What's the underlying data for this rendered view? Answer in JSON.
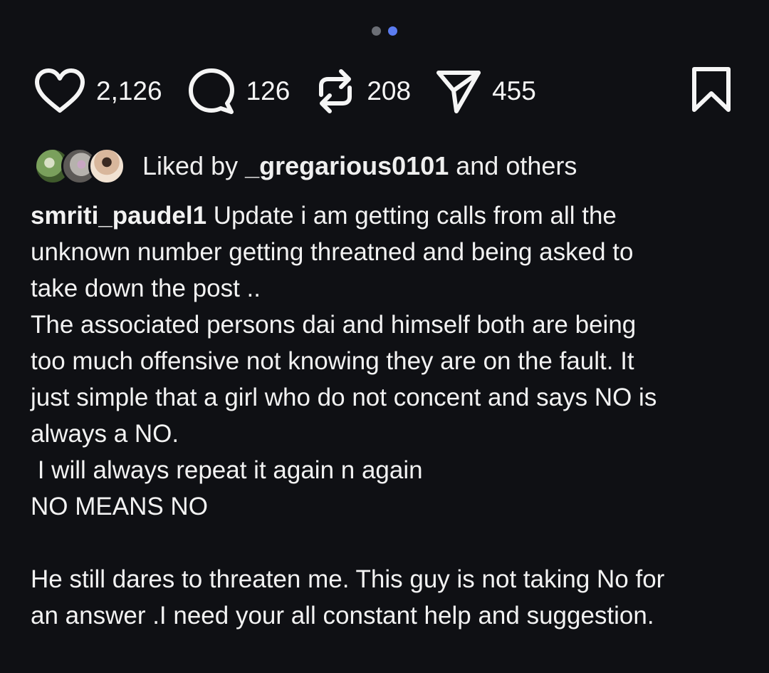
{
  "pager": {
    "count": 2,
    "active_index": 1
  },
  "actions": {
    "like_count": "2,126",
    "comment_count": "126",
    "repost_count": "208",
    "share_count": "455"
  },
  "liked_by": {
    "prefix": "Liked by ",
    "user": "_gregarious0101",
    "suffix": " and others"
  },
  "caption": {
    "username": "smriti_paudel1",
    "line1": " Update i am getting calls from all the",
    "line2": "unknown number getting threatned and being asked to",
    "line3": "take down the post ..",
    "line4": "The associated persons dai and himself both are being",
    "line5": "too much offensive not knowing they are on the fault. It",
    "line6": "just simple that a girl who do not concent and says NO is",
    "line7": "always a NO.",
    "line8": " I will always repeat it again n again",
    "line9": "NO MEANS NO",
    "line10": "He still dares to threaten me. This guy is not taking No for",
    "line11": "an answer .I need your all constant help and suggestion."
  },
  "colors": {
    "background": "#0f1014",
    "text": "#f2f2f2",
    "pager_active": "#5b7cf0",
    "pager_inactive": "#6b6e75"
  }
}
